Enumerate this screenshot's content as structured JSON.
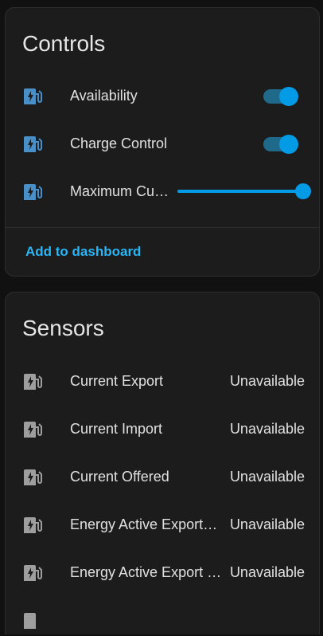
{
  "controls": {
    "title": "Controls",
    "items": [
      {
        "label": "Availability",
        "state": "on"
      },
      {
        "label": "Charge Control",
        "state": "on"
      },
      {
        "label": "Maximum Current",
        "slider_fraction": 1.0
      }
    ],
    "add_link": "Add to dashboard"
  },
  "sensors": {
    "title": "Sensors",
    "items": [
      {
        "label": "Current Export",
        "value": "Unavailable"
      },
      {
        "label": "Current Import",
        "value": "Unavailable"
      },
      {
        "label": "Current Offered",
        "value": "Unavailable"
      },
      {
        "label": "Energy Active Export Interval",
        "value": "Unavailable"
      },
      {
        "label": "Energy Active Export Register",
        "value": "Unavailable"
      }
    ]
  },
  "colors": {
    "accent": "#039be5",
    "active_icon": "#4a90c8",
    "inactive_icon": "#9e9e9e",
    "link": "#29b6f6"
  },
  "icons": {
    "control_icon": "ev-station-icon",
    "sensor_icon": "ev-station-icon"
  }
}
